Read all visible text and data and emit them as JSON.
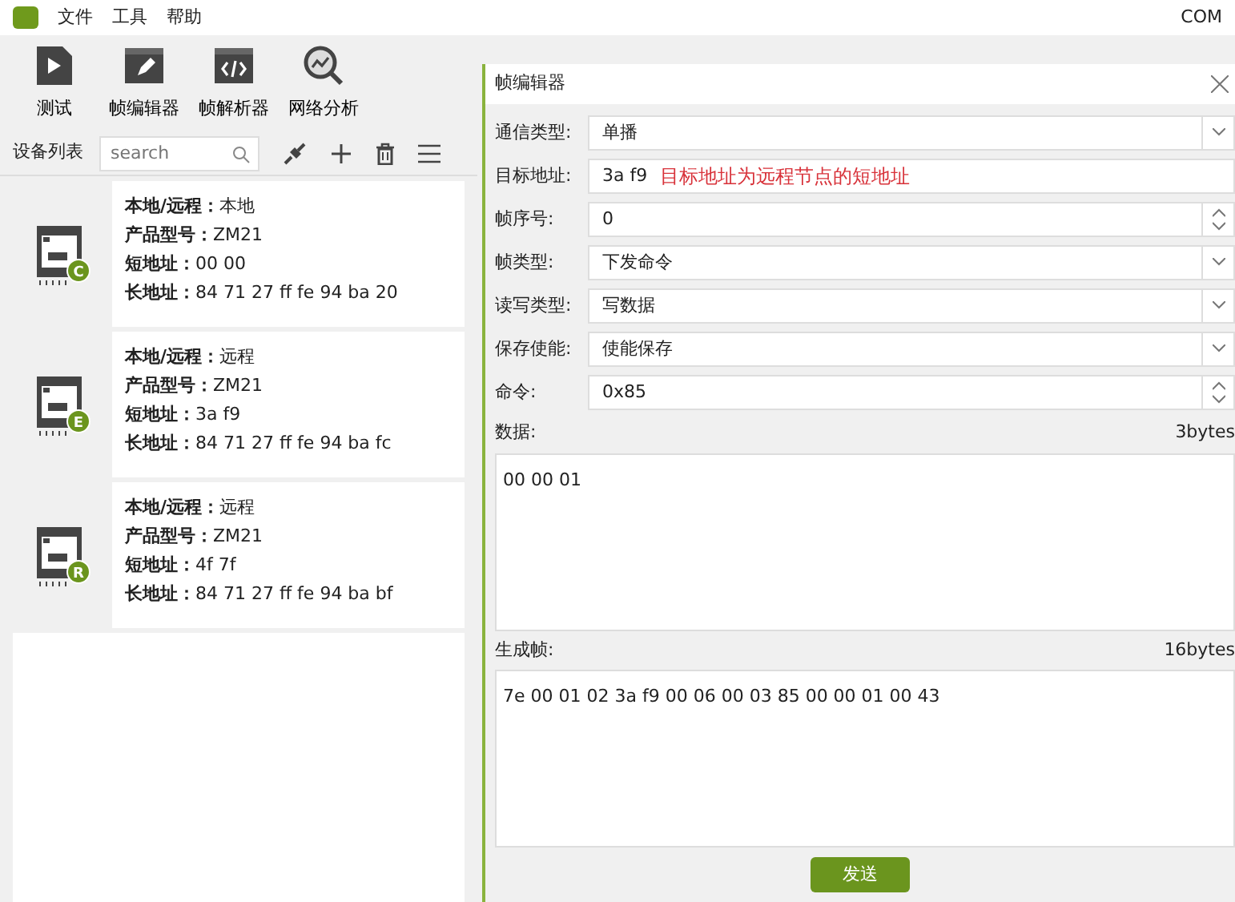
{
  "menu": [
    "文件",
    "工具",
    "帮助"
  ],
  "status": "COM",
  "toolbar": [
    {
      "label": "测试"
    },
    {
      "label": "帧编辑器"
    },
    {
      "label": "帧解析器"
    },
    {
      "label": "网络分析"
    }
  ],
  "device_list": {
    "title": "设备列表",
    "search": {
      "placeholder": "search"
    }
  },
  "devices": [
    {
      "badge": "C",
      "lines": [
        "**本地/远程：**本地",
        "**产品型号：**ZM21",
        "**短地址：**00 00",
        "**长地址：**84 71 27 ff fe 94 ba 20"
      ]
    },
    {
      "badge": "E",
      "lines": [
        "**本地/远程：**远程",
        "**产品型号：**ZM21",
        "**短地址：**3a f9",
        "**长地址：**84 71 27 ff fe 94 ba fc"
      ]
    },
    {
      "badge": "R",
      "lines": [
        "**本地/远程：**远程",
        "**产品型号：**ZM21",
        "**短地址：**4f 7f",
        "**长地址：**84 71 27 ff fe 94 ba bf"
      ]
    }
  ],
  "dialog": {
    "title": "帧编辑器",
    "fields": [
      {
        "label": "通信类型:",
        "kind": "select",
        "value": "单播"
      },
      {
        "label": "目标地址:",
        "kind": "text",
        "value": "3a f9",
        "note": "目标地址为远程节点的短地址"
      },
      {
        "label": "帧序号:",
        "kind": "spin",
        "value": "0"
      },
      {
        "label": "帧类型:",
        "kind": "select",
        "value": "下发命令"
      },
      {
        "label": "读写类型:",
        "kind": "select",
        "value": "写数据"
      },
      {
        "label": "保存使能:",
        "kind": "select",
        "value": "使能保存"
      },
      {
        "label": "命令:",
        "kind": "spin",
        "value": "0x85"
      }
    ],
    "data": {
      "label": "数据:",
      "size": "3bytes",
      "value": "00 00 01"
    },
    "frame": {
      "label": "生成帧:",
      "size": "16bytes",
      "value": "7e 00 01 02 3a f9 00 06 00 03 85 00 00 01 00 43"
    },
    "send": "发送"
  }
}
